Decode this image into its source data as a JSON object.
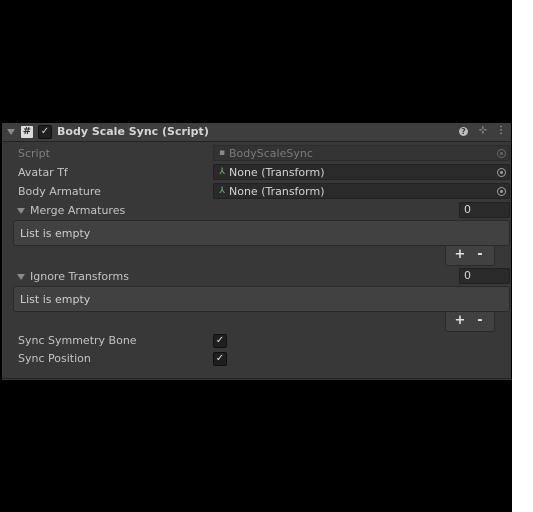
{
  "component": {
    "title": "Body Scale Sync (Script)",
    "enabled": true,
    "header_icons": [
      "help-icon",
      "preset-icon",
      "context-menu-icon"
    ]
  },
  "fields": {
    "script": {
      "label": "Script",
      "value": "BodyScaleSync",
      "icon": "script-file-icon",
      "disabled": true
    },
    "avatar_tf": {
      "label": "Avatar Tf",
      "value": "None (Transform)",
      "icon": "transform-icon"
    },
    "body_armature": {
      "label": "Body Armature",
      "value": "None (Transform)",
      "icon": "transform-icon"
    }
  },
  "lists": {
    "merge_armatures": {
      "label": "Merge Armatures",
      "size": "0",
      "empty_text": "List is empty",
      "add_label": "+",
      "remove_label": "-"
    },
    "ignore_transforms": {
      "label": "Ignore Transforms",
      "size": "0",
      "empty_text": "List is empty",
      "add_label": "+",
      "remove_label": "-"
    }
  },
  "toggles": {
    "sync_symmetry_bone": {
      "label": "Sync Symmetry Bone",
      "checked": true
    },
    "sync_position": {
      "label": "Sync Position",
      "checked": true
    }
  },
  "glyphs": {
    "check": "✓",
    "hash": "#",
    "help": "?",
    "preset": "⊹",
    "menu": "⋮",
    "transform": "⅄",
    "script": "▪"
  },
  "colors": {
    "panel_bg": "#383838",
    "header_bg": "#3e3e3e",
    "field_bg": "#2a2a2a",
    "list_bg": "#414141",
    "text": "#c4c4c4",
    "disabled_text": "#7f7f7f",
    "transform_icon_green": "#7ec07a"
  }
}
